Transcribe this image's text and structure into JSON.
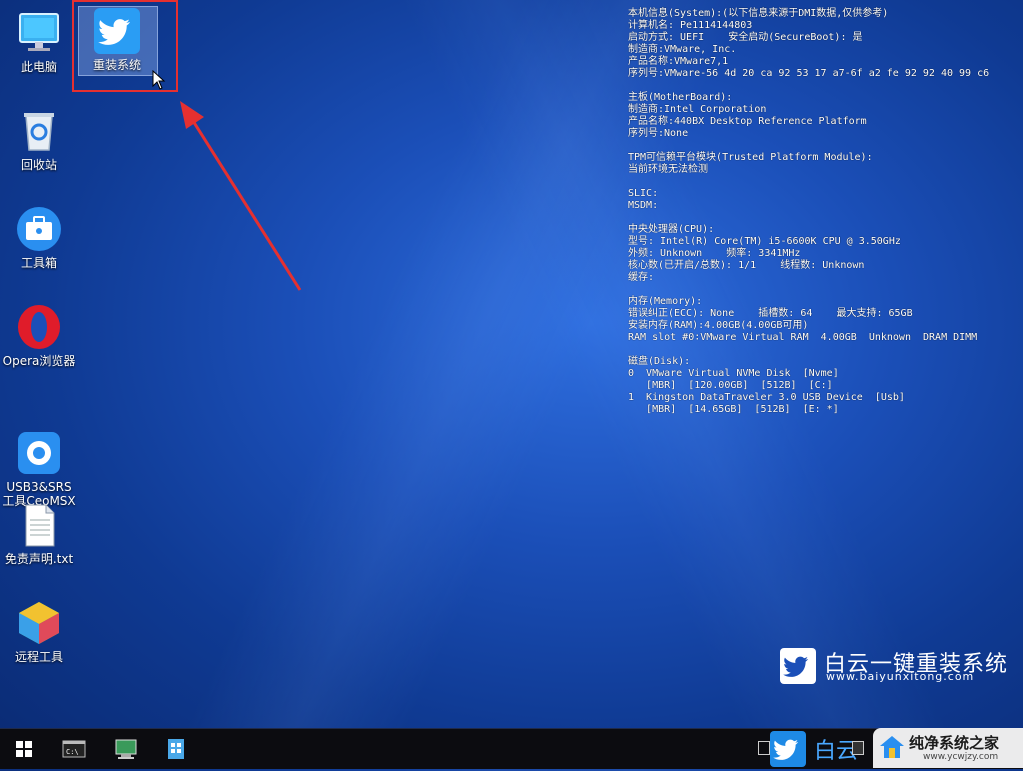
{
  "desktop": {
    "icons": [
      {
        "label": "此电脑",
        "icon": "computer-icon"
      },
      {
        "label": "重装系统",
        "icon": "bird-icon"
      },
      {
        "label": "回收站",
        "icon": "recycle-bin-icon"
      },
      {
        "label": "工具箱",
        "icon": "toolbox-icon"
      },
      {
        "label": "Opera浏览器",
        "icon": "opera-icon"
      },
      {
        "label": "USB3&SRS\n工具CeoMSX",
        "icon": "usb-tool-icon"
      },
      {
        "label": "免责声明.txt",
        "icon": "text-file-icon"
      },
      {
        "label": "远程工具",
        "icon": "remote-tool-icon"
      }
    ]
  },
  "sysinfo": [
    "本机信息(System):(以下信息来源于DMI数据,仅供参考)",
    "计算机名: Pe1114144803",
    "启动方式: UEFI    安全启动(SecureBoot): 是",
    "制造商:VMware, Inc.",
    "产品名称:VMware7,1",
    "序列号:VMware-56 4d 20 ca 92 53 17 a7-6f a2 fe 92 92 40 99 c6",
    "",
    "主板(MotherBoard):",
    "制造商:Intel Corporation",
    "产品名称:440BX Desktop Reference Platform",
    "序列号:None",
    "",
    "TPM可信赖平台模块(Trusted Platform Module):",
    "当前环境无法检测",
    "",
    "SLIC:",
    "MSDM:",
    "",
    "中央处理器(CPU):",
    "型号: Intel(R) Core(TM) i5-6600K CPU @ 3.50GHz",
    "外频: Unknown    频率: 3341MHz",
    "核心数(已开启/总数): 1/1    线程数: Unknown",
    "缓存:",
    "",
    "内存(Memory):",
    "错误纠正(ECC): None    插槽数: 64    最大支持: 65GB",
    "安装内存(RAM):4.00GB(4.00GB可用)",
    "RAM slot #0∶VMware Virtual RAM  4.00GB  Unknown  DRAM DIMM",
    "",
    "磁盘(Disk):",
    "0  VMware Virtual NVMe Disk  [Nvme]",
    "   [MBR]  [120.00GB]  [512B]  [C:]",
    "1  Kingston DataTraveler 3.0 USB Device  [Usb]",
    "   [MBR]  [14.65GB]  [512B]  [E: *]"
  ],
  "brand": {
    "name": "白云一键重装系统",
    "url": "www.baiyunxitong.com"
  },
  "taskbar": {
    "items": [
      "windows-start-icon",
      "cmd-icon",
      "system-tool-icon",
      "network-tool-icon"
    ],
    "tray_label": "白云"
  },
  "watermark": {
    "text": "纯净系统之家",
    "url": "www.ycwjzy.com"
  },
  "colors": {
    "accent": "#1e8ae6",
    "highlight_border": "#e53030",
    "arrow": "#e53030"
  }
}
